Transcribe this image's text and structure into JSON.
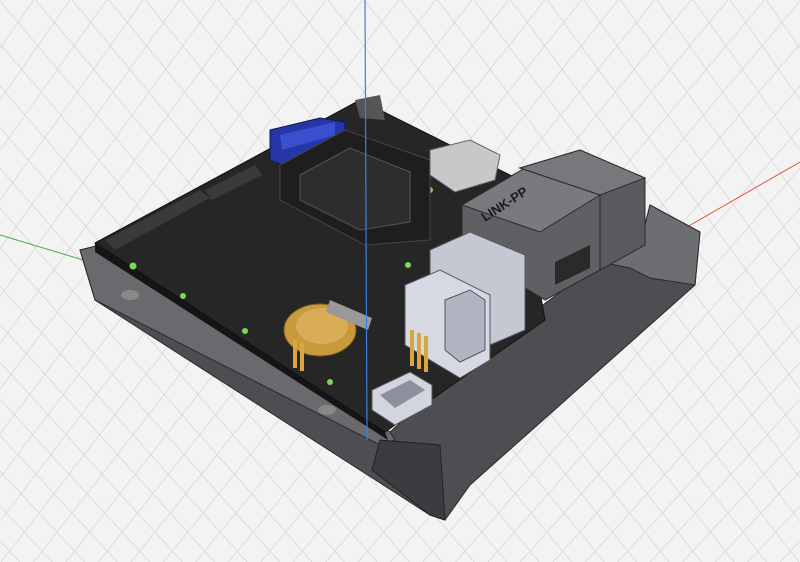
{
  "viewport": {
    "background": "#f3f3f4",
    "grid_color": "#d2d4d8",
    "axis_colors": {
      "x": "#e0553f",
      "y": "#49a84d",
      "z": "#3d7fe0"
    }
  },
  "model": {
    "rj45_label": "LINK-PP",
    "colors": {
      "pcb": "#262626",
      "case": "#5a5a5e",
      "jack": "#6f6f73",
      "blue_connector": "#2436a8",
      "battery": "#c89a3c",
      "usb": "#c9ccd6"
    }
  }
}
